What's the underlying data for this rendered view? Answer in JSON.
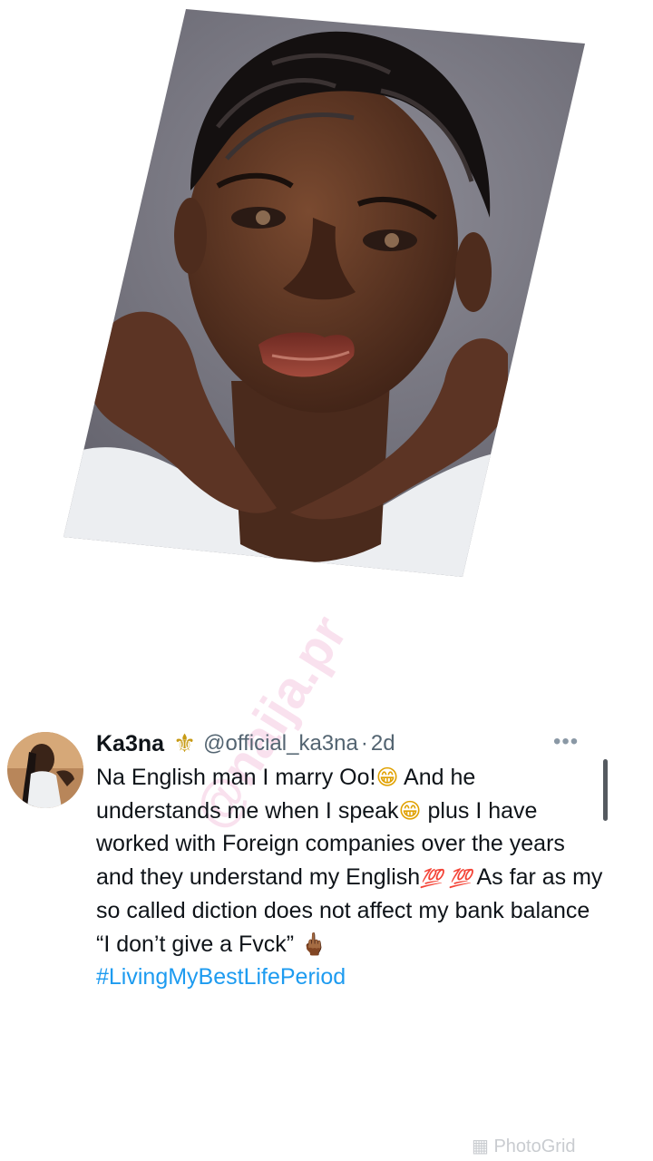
{
  "tweet": {
    "display_name": "Ka3na",
    "badge_icon": "fleur-de-lis-icon",
    "badge_glyph": "⚜",
    "handle": "@official_ka3na",
    "separator": "·",
    "time": "2d",
    "more_label": "•••",
    "text_1": "Na English man I marry Oo!",
    "emoji_grin": "😁",
    "text_2": " And he understands me when I speak",
    "text_3": " plus I have worked with Foreign companies over the years and they understand my English",
    "emoji_hundred": "💯",
    "text_4": " As far as my so called diction does not affect my bank balance “I don’t give a Fvck” ",
    "emoji_finger": "🖕🏾",
    "hashtag": "#LivingMyBestLifePeriod"
  },
  "watermark": "@naija.pr",
  "footer": {
    "photogrid": "PhotoGrid",
    "photogrid_icon": "grid-icon"
  },
  "colors": {
    "link": "#1d9bf0",
    "secondary_text": "#536471",
    "badge": "#c79a14",
    "photo_background": "#7b7a84"
  }
}
